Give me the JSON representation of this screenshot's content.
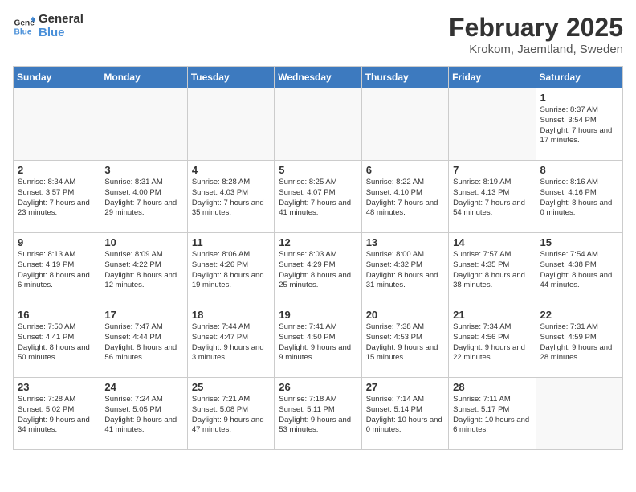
{
  "logo": {
    "line1": "General",
    "line2": "Blue"
  },
  "title": {
    "month_year": "February 2025",
    "location": "Krokom, Jaemtland, Sweden"
  },
  "weekdays": [
    "Sunday",
    "Monday",
    "Tuesday",
    "Wednesday",
    "Thursday",
    "Friday",
    "Saturday"
  ],
  "weeks": [
    [
      {
        "day": "",
        "info": ""
      },
      {
        "day": "",
        "info": ""
      },
      {
        "day": "",
        "info": ""
      },
      {
        "day": "",
        "info": ""
      },
      {
        "day": "",
        "info": ""
      },
      {
        "day": "",
        "info": ""
      },
      {
        "day": "1",
        "info": "Sunrise: 8:37 AM\nSunset: 3:54 PM\nDaylight: 7 hours and 17 minutes."
      }
    ],
    [
      {
        "day": "2",
        "info": "Sunrise: 8:34 AM\nSunset: 3:57 PM\nDaylight: 7 hours and 23 minutes."
      },
      {
        "day": "3",
        "info": "Sunrise: 8:31 AM\nSunset: 4:00 PM\nDaylight: 7 hours and 29 minutes."
      },
      {
        "day": "4",
        "info": "Sunrise: 8:28 AM\nSunset: 4:03 PM\nDaylight: 7 hours and 35 minutes."
      },
      {
        "day": "5",
        "info": "Sunrise: 8:25 AM\nSunset: 4:07 PM\nDaylight: 7 hours and 41 minutes."
      },
      {
        "day": "6",
        "info": "Sunrise: 8:22 AM\nSunset: 4:10 PM\nDaylight: 7 hours and 48 minutes."
      },
      {
        "day": "7",
        "info": "Sunrise: 8:19 AM\nSunset: 4:13 PM\nDaylight: 7 hours and 54 minutes."
      },
      {
        "day": "8",
        "info": "Sunrise: 8:16 AM\nSunset: 4:16 PM\nDaylight: 8 hours and 0 minutes."
      }
    ],
    [
      {
        "day": "9",
        "info": "Sunrise: 8:13 AM\nSunset: 4:19 PM\nDaylight: 8 hours and 6 minutes."
      },
      {
        "day": "10",
        "info": "Sunrise: 8:09 AM\nSunset: 4:22 PM\nDaylight: 8 hours and 12 minutes."
      },
      {
        "day": "11",
        "info": "Sunrise: 8:06 AM\nSunset: 4:26 PM\nDaylight: 8 hours and 19 minutes."
      },
      {
        "day": "12",
        "info": "Sunrise: 8:03 AM\nSunset: 4:29 PM\nDaylight: 8 hours and 25 minutes."
      },
      {
        "day": "13",
        "info": "Sunrise: 8:00 AM\nSunset: 4:32 PM\nDaylight: 8 hours and 31 minutes."
      },
      {
        "day": "14",
        "info": "Sunrise: 7:57 AM\nSunset: 4:35 PM\nDaylight: 8 hours and 38 minutes."
      },
      {
        "day": "15",
        "info": "Sunrise: 7:54 AM\nSunset: 4:38 PM\nDaylight: 8 hours and 44 minutes."
      }
    ],
    [
      {
        "day": "16",
        "info": "Sunrise: 7:50 AM\nSunset: 4:41 PM\nDaylight: 8 hours and 50 minutes."
      },
      {
        "day": "17",
        "info": "Sunrise: 7:47 AM\nSunset: 4:44 PM\nDaylight: 8 hours and 56 minutes."
      },
      {
        "day": "18",
        "info": "Sunrise: 7:44 AM\nSunset: 4:47 PM\nDaylight: 9 hours and 3 minutes."
      },
      {
        "day": "19",
        "info": "Sunrise: 7:41 AM\nSunset: 4:50 PM\nDaylight: 9 hours and 9 minutes."
      },
      {
        "day": "20",
        "info": "Sunrise: 7:38 AM\nSunset: 4:53 PM\nDaylight: 9 hours and 15 minutes."
      },
      {
        "day": "21",
        "info": "Sunrise: 7:34 AM\nSunset: 4:56 PM\nDaylight: 9 hours and 22 minutes."
      },
      {
        "day": "22",
        "info": "Sunrise: 7:31 AM\nSunset: 4:59 PM\nDaylight: 9 hours and 28 minutes."
      }
    ],
    [
      {
        "day": "23",
        "info": "Sunrise: 7:28 AM\nSunset: 5:02 PM\nDaylight: 9 hours and 34 minutes."
      },
      {
        "day": "24",
        "info": "Sunrise: 7:24 AM\nSunset: 5:05 PM\nDaylight: 9 hours and 41 minutes."
      },
      {
        "day": "25",
        "info": "Sunrise: 7:21 AM\nSunset: 5:08 PM\nDaylight: 9 hours and 47 minutes."
      },
      {
        "day": "26",
        "info": "Sunrise: 7:18 AM\nSunset: 5:11 PM\nDaylight: 9 hours and 53 minutes."
      },
      {
        "day": "27",
        "info": "Sunrise: 7:14 AM\nSunset: 5:14 PM\nDaylight: 10 hours and 0 minutes."
      },
      {
        "day": "28",
        "info": "Sunrise: 7:11 AM\nSunset: 5:17 PM\nDaylight: 10 hours and 6 minutes."
      },
      {
        "day": "",
        "info": ""
      }
    ]
  ]
}
